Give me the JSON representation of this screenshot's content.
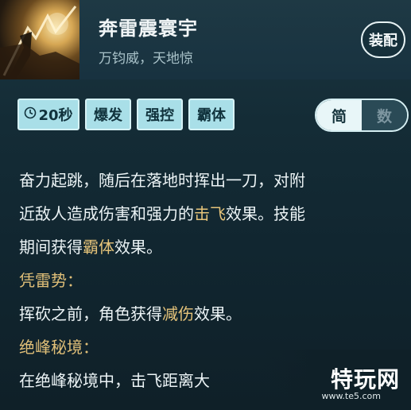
{
  "skill": {
    "name": "奔雷震寰宇",
    "subtitle": "万钧威，天地惊",
    "equip_label": "装配"
  },
  "tags": [
    {
      "label": "20秒",
      "icon": "clock-icon"
    },
    {
      "label": "爆发"
    },
    {
      "label": "强控"
    },
    {
      "label": "霸体"
    }
  ],
  "toggle": {
    "simple_label": "简",
    "numeric_label": "数",
    "active": "simple"
  },
  "description": {
    "line1": "奋力起跳，随后在落地时挥出一刀，对附",
    "line2_a": "近敌人造成伤害和强力的",
    "line2_hl": "击飞",
    "line2_b": "效果。技能",
    "line3_a": "期间获得",
    "line3_hl": "霸体",
    "line3_b": "效果。",
    "section1_title": "凭雷势：",
    "section1_a": "挥砍之前，角色获得",
    "section1_hl": "减伤",
    "section1_b": "效果。",
    "section2_title": "绝峰秘境：",
    "section2_text": "在绝峰秘境中，击飞距离大"
  },
  "watermark": {
    "text": "特玩网",
    "url": "www.te5.com"
  },
  "colors": {
    "highlight": "#e6c47a",
    "tag_bg": "#a9dfe8",
    "panel_bg": "#142c36"
  }
}
